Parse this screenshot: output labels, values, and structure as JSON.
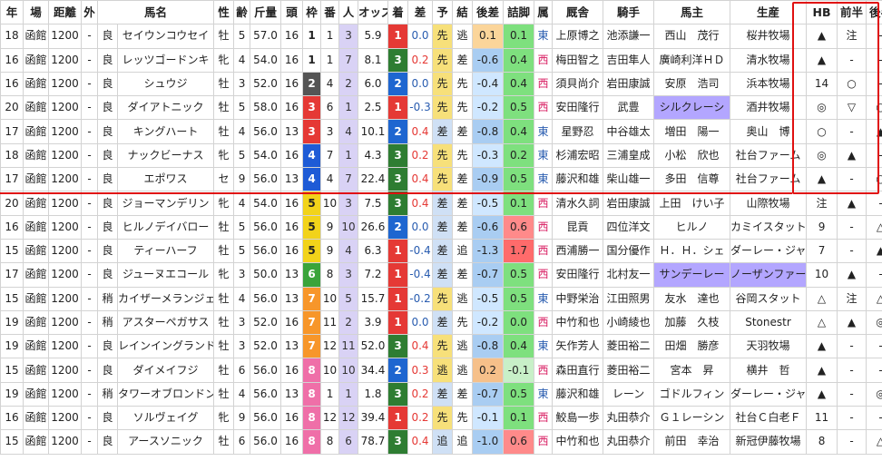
{
  "headers": [
    "年",
    "場",
    "距離",
    "外",
    "馬名",
    "性",
    "齢",
    "斤量",
    "頭",
    "枠",
    "番",
    "人",
    "オッズ",
    "着",
    "差",
    "予",
    "結",
    "後差",
    "詰脚",
    "属",
    "厩舎",
    "騎手",
    "馬主",
    "生産",
    "HB",
    "前半",
    "後半"
  ],
  "rows": [
    {
      "year": "18",
      "venue": "函館",
      "dist": "1200",
      "out": "-",
      "cond": "良",
      "name": "セイウンコウセイ",
      "sex": "牡",
      "age": "5",
      "wt": "57.0",
      "heads": "16",
      "waku": "1",
      "ban": "1",
      "ninki": "3",
      "odds": "5.9",
      "chaku": "1",
      "sa": "0.0",
      "yo": "先",
      "ke": "逃",
      "atosa": "0.1",
      "tsume": "0.1",
      "zoku": "東",
      "kyu": "上原博之",
      "jockey": "池添謙一",
      "owner": "西山　茂行",
      "breeder": "桜井牧場",
      "hb": "▲",
      "zen": "注",
      "kou": "-"
    },
    {
      "year": "16",
      "venue": "函館",
      "dist": "1200",
      "out": "-",
      "cond": "良",
      "name": "レッツゴードンキ",
      "sex": "牝",
      "age": "4",
      "wt": "54.0",
      "heads": "16",
      "waku": "1",
      "ban": "1",
      "ninki": "7",
      "odds": "8.1",
      "chaku": "3",
      "sa": "0.2",
      "yo": "先",
      "ke": "差",
      "atosa": "-0.6",
      "tsume": "0.4",
      "zoku": "西",
      "kyu": "梅田智之",
      "jockey": "吉田隼人",
      "owner": "廣崎利洋ＨＤ",
      "breeder": "清水牧場",
      "hb": "▲",
      "zen": "-",
      "kou": "-"
    },
    {
      "year": "16",
      "venue": "函館",
      "dist": "1200",
      "out": "-",
      "cond": "良",
      "name": "シュウジ",
      "sex": "牡",
      "age": "3",
      "wt": "52.0",
      "heads": "16",
      "waku": "2",
      "ban": "4",
      "ninki": "2",
      "odds": "6.0",
      "chaku": "2",
      "sa": "0.0",
      "yo": "先",
      "ke": "先",
      "atosa": "-0.4",
      "tsume": "0.4",
      "zoku": "西",
      "kyu": "須貝尚介",
      "jockey": "岩田康誠",
      "owner": "安原　浩司",
      "breeder": "浜本牧場",
      "hb": "14",
      "zen": "○",
      "kou": "-"
    },
    {
      "year": "20",
      "venue": "函館",
      "dist": "1200",
      "out": "-",
      "cond": "良",
      "name": "ダイアトニック",
      "sex": "牡",
      "age": "5",
      "wt": "58.0",
      "heads": "16",
      "waku": "3",
      "ban": "6",
      "ninki": "1",
      "odds": "2.5",
      "chaku": "1",
      "sa": "-0.3",
      "yo": "先",
      "ke": "先",
      "atosa": "-0.2",
      "tsume": "0.5",
      "zoku": "西",
      "kyu": "安田隆行",
      "jockey": "武豊",
      "owner": "シルクレーシ",
      "breeder": "酒井牧場",
      "hb": "◎",
      "zen": "▽",
      "kou": "○"
    },
    {
      "year": "17",
      "venue": "函館",
      "dist": "1200",
      "out": "-",
      "cond": "良",
      "name": "キングハート",
      "sex": "牡",
      "age": "4",
      "wt": "56.0",
      "heads": "13",
      "waku": "3",
      "ban": "3",
      "ninki": "4",
      "odds": "10.1",
      "chaku": "2",
      "sa": "0.4",
      "yo": "差",
      "ke": "差",
      "atosa": "-0.8",
      "tsume": "0.4",
      "zoku": "東",
      "kyu": "星野忍",
      "jockey": "中谷雄太",
      "owner": "増田　陽一",
      "breeder": "奥山　博",
      "hb": "○",
      "zen": "-",
      "kou": "▲"
    },
    {
      "year": "18",
      "venue": "函館",
      "dist": "1200",
      "out": "-",
      "cond": "良",
      "name": "ナックビーナス",
      "sex": "牝",
      "age": "5",
      "wt": "54.0",
      "heads": "16",
      "waku": "4",
      "ban": "7",
      "ninki": "1",
      "odds": "4.3",
      "chaku": "3",
      "sa": "0.2",
      "yo": "先",
      "ke": "先",
      "atosa": "-0.3",
      "tsume": "0.2",
      "zoku": "東",
      "kyu": "杉浦宏昭",
      "jockey": "三浦皇成",
      "owner": "小松　欣也",
      "breeder": "社台ファーム",
      "hb": "◎",
      "zen": "▲",
      "kou": "-"
    },
    {
      "year": "17",
      "venue": "函館",
      "dist": "1200",
      "out": "-",
      "cond": "良",
      "name": "エポワス",
      "sex": "セ",
      "age": "9",
      "wt": "56.0",
      "heads": "13",
      "waku": "4",
      "ban": "4",
      "ninki": "7",
      "odds": "22.4",
      "chaku": "3",
      "sa": "0.4",
      "yo": "先",
      "ke": "差",
      "atosa": "-0.9",
      "tsume": "0.5",
      "zoku": "東",
      "kyu": "藤沢和雄",
      "jockey": "柴山雄一",
      "owner": "多田　信尊",
      "breeder": "社台ファーム",
      "hb": "▲",
      "zen": "-",
      "kou": "○"
    },
    {
      "year": "20",
      "venue": "函館",
      "dist": "1200",
      "out": "-",
      "cond": "良",
      "name": "ジョーマンデリン",
      "sex": "牝",
      "age": "4",
      "wt": "54.0",
      "heads": "16",
      "waku": "5",
      "ban": "10",
      "ninki": "3",
      "odds": "7.5",
      "chaku": "3",
      "sa": "0.4",
      "yo": "差",
      "ke": "差",
      "atosa": "-0.5",
      "tsume": "0.1",
      "zoku": "西",
      "kyu": "清水久詞",
      "jockey": "岩田康誠",
      "owner": "上田　けい子",
      "breeder": "山際牧場",
      "hb": "注",
      "zen": "▲",
      "kou": "-"
    },
    {
      "year": "16",
      "venue": "函館",
      "dist": "1200",
      "out": "-",
      "cond": "良",
      "name": "ヒルノデイバロー",
      "sex": "牡",
      "age": "5",
      "wt": "56.0",
      "heads": "16",
      "waku": "5",
      "ban": "9",
      "ninki": "10",
      "odds": "26.6",
      "chaku": "2",
      "sa": "0.0",
      "yo": "差",
      "ke": "差",
      "atosa": "-0.6",
      "tsume": "0.6",
      "zoku": "西",
      "kyu": "昆貢",
      "jockey": "四位洋文",
      "owner": "ヒルノ",
      "breeder": "カミイスタット",
      "hb": "9",
      "zen": "-",
      "kou": "△"
    },
    {
      "year": "15",
      "venue": "函館",
      "dist": "1200",
      "out": "-",
      "cond": "良",
      "name": "ティーハーフ",
      "sex": "牡",
      "age": "5",
      "wt": "56.0",
      "heads": "16",
      "waku": "5",
      "ban": "9",
      "ninki": "4",
      "odds": "6.3",
      "chaku": "1",
      "sa": "-0.4",
      "yo": "差",
      "ke": "追",
      "atosa": "-1.3",
      "tsume": "1.7",
      "zoku": "西",
      "kyu": "西浦勝一",
      "jockey": "国分優作",
      "owner": "Ｈ．Ｈ．シェ",
      "breeder": "ダーレー・ジャパ",
      "hb": "7",
      "zen": "-",
      "kou": "▲"
    },
    {
      "year": "17",
      "venue": "函館",
      "dist": "1200",
      "out": "-",
      "cond": "良",
      "name": "ジューヌエコール",
      "sex": "牝",
      "age": "3",
      "wt": "50.0",
      "heads": "13",
      "waku": "6",
      "ban": "8",
      "ninki": "3",
      "odds": "7.2",
      "chaku": "1",
      "sa": "-0.4",
      "yo": "差",
      "ke": "差",
      "atosa": "-0.7",
      "tsume": "0.5",
      "zoku": "西",
      "kyu": "安田隆行",
      "jockey": "北村友一",
      "owner": "サンデーレー",
      "breeder": "ノーザンファーム",
      "hb": "10",
      "zen": "▲",
      "kou": "-"
    },
    {
      "year": "15",
      "venue": "函館",
      "dist": "1200",
      "out": "-",
      "cond": "稍",
      "name": "カイザーメランジェ",
      "sex": "牡",
      "age": "4",
      "wt": "56.0",
      "heads": "13",
      "waku": "7",
      "ban": "10",
      "ninki": "5",
      "odds": "15.7",
      "chaku": "1",
      "sa": "-0.2",
      "yo": "先",
      "ke": "逃",
      "atosa": "-0.5",
      "tsume": "0.5",
      "zoku": "東",
      "kyu": "中野栄治",
      "jockey": "江田照男",
      "owner": "友水　達也",
      "breeder": "谷岡スタット",
      "hb": "△",
      "zen": "注",
      "kou": "△"
    },
    {
      "year": "19",
      "venue": "函館",
      "dist": "1200",
      "out": "-",
      "cond": "稍",
      "name": "アスターペガサス",
      "sex": "牡",
      "age": "3",
      "wt": "52.0",
      "heads": "16",
      "waku": "7",
      "ban": "11",
      "ninki": "2",
      "odds": "3.9",
      "chaku": "1",
      "sa": "0.0",
      "yo": "差",
      "ke": "先",
      "atosa": "-0.2",
      "tsume": "0.0",
      "zoku": "西",
      "kyu": "中竹和也",
      "jockey": "小崎綾也",
      "owner": "加藤　久枝",
      "breeder": "Stonestr",
      "hb": "△",
      "zen": "▲",
      "kou": "◎"
    },
    {
      "year": "19",
      "venue": "函館",
      "dist": "1200",
      "out": "-",
      "cond": "良",
      "name": "レインイングランド",
      "sex": "牡",
      "age": "3",
      "wt": "52.0",
      "heads": "13",
      "waku": "7",
      "ban": "12",
      "ninki": "11",
      "odds": "52.0",
      "chaku": "3",
      "sa": "0.4",
      "yo": "先",
      "ke": "逃",
      "atosa": "-0.8",
      "tsume": "0.4",
      "zoku": "東",
      "kyu": "矢作芳人",
      "jockey": "菱田裕二",
      "owner": "田畑　勝彦",
      "breeder": "天羽牧場",
      "hb": "▲",
      "zen": "-",
      "kou": "-"
    },
    {
      "year": "15",
      "venue": "函館",
      "dist": "1200",
      "out": "-",
      "cond": "良",
      "name": "ダイメイフジ",
      "sex": "牡",
      "age": "6",
      "wt": "56.0",
      "heads": "16",
      "waku": "8",
      "ban": "10",
      "ninki": "10",
      "odds": "34.4",
      "chaku": "2",
      "sa": "0.3",
      "yo": "逃",
      "ke": "逃",
      "atosa": "0.2",
      "tsume": "-0.1",
      "zoku": "西",
      "kyu": "森田直行",
      "jockey": "菱田裕二",
      "owner": "宮本　昇",
      "breeder": "横井　哲",
      "hb": "▲",
      "zen": "-",
      "kou": "-"
    },
    {
      "year": "19",
      "venue": "函館",
      "dist": "1200",
      "out": "-",
      "cond": "稍",
      "name": "タワーオブロンドン",
      "sex": "牡",
      "age": "4",
      "wt": "56.0",
      "heads": "13",
      "waku": "8",
      "ban": "1",
      "ninki": "1",
      "odds": "1.8",
      "chaku": "3",
      "sa": "0.2",
      "yo": "差",
      "ke": "差",
      "atosa": "-0.7",
      "tsume": "0.5",
      "zoku": "東",
      "kyu": "藤沢和雄",
      "jockey": "レーン",
      "owner": "ゴドルフィン",
      "breeder": "ダーレー・ジャパ",
      "hb": "▲",
      "zen": "-",
      "kou": "◎"
    },
    {
      "year": "16",
      "venue": "函館",
      "dist": "1200",
      "out": "-",
      "cond": "良",
      "name": "ソルヴェイグ",
      "sex": "牝",
      "age": "9",
      "wt": "56.0",
      "heads": "16",
      "waku": "8",
      "ban": "12",
      "ninki": "12",
      "odds": "39.4",
      "chaku": "1",
      "sa": "0.2",
      "yo": "先",
      "ke": "先",
      "atosa": "-0.1",
      "tsume": "0.1",
      "zoku": "西",
      "kyu": "鮫島一歩",
      "jockey": "丸田恭介",
      "owner": "Ｇ１レーシン",
      "breeder": "社台Ｃ白老Ｆ",
      "hb": "11",
      "zen": "-",
      "kou": "-"
    },
    {
      "year": "15",
      "venue": "函館",
      "dist": "1200",
      "out": "-",
      "cond": "良",
      "name": "アースソニック",
      "sex": "牡",
      "age": "6",
      "wt": "56.0",
      "heads": "16",
      "waku": "8",
      "ban": "8",
      "ninki": "6",
      "odds": "78.7",
      "chaku": "3",
      "sa": "0.4",
      "yo": "追",
      "ke": "追",
      "atosa": "-1.0",
      "tsume": "0.6",
      "zoku": "西",
      "kyu": "中竹和也",
      "jockey": "丸田恭介",
      "owner": "前田　幸治",
      "breeder": "新冠伊藤牧場",
      "hb": "8",
      "zen": "-",
      "kou": "△"
    }
  ],
  "colors": {
    "waku": {
      "1": "#ffffff",
      "2": "#555555",
      "3": "#e53935",
      "4": "#1e5bd6",
      "5": "#f2d31a",
      "6": "#3aa43a",
      "7": "#f7962a",
      "8": "#ef6fa8"
    },
    "chaku": {
      "1": "#e53935",
      "2": "#1e66d0",
      "3": "#2e7d32"
    },
    "accent_red": "#e01010",
    "owner_highlight": "#b3a6ff"
  }
}
